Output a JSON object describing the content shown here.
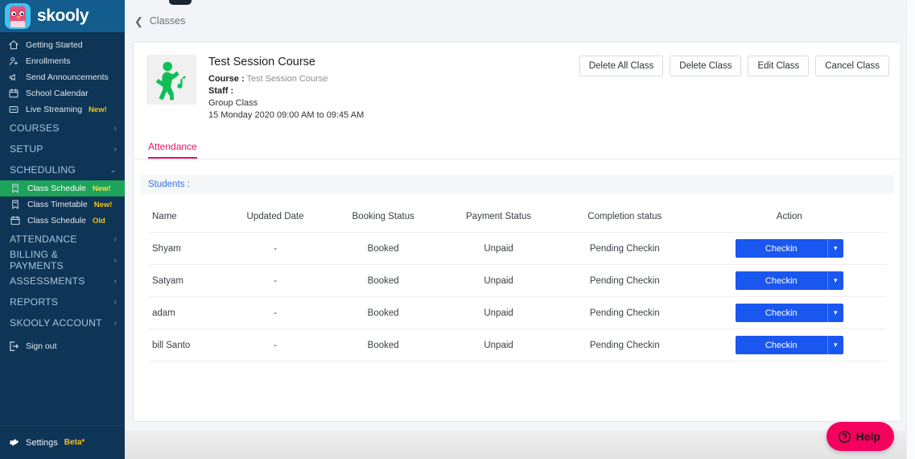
{
  "brand": {
    "name": "skooly",
    "logo_icon": "owl-logo-icon",
    "bar_color": "#125d8e"
  },
  "sidebar": {
    "items": [
      {
        "label": "Getting Started",
        "icon": "home-icon"
      },
      {
        "label": "Enrollments",
        "icon": "person-add-icon"
      },
      {
        "label": "Send Announcements",
        "icon": "megaphone-icon"
      },
      {
        "label": "School Calendar",
        "icon": "calendar-icon"
      },
      {
        "label": "Live Streaming",
        "icon": "video-icon",
        "badge": "New!"
      }
    ],
    "groups": [
      {
        "label": "COURSES",
        "chevron": "›",
        "expanded": false
      },
      {
        "label": "SETUP",
        "chevron": "›",
        "expanded": false
      },
      {
        "label": "SCHEDULING",
        "chevron": "⌄",
        "expanded": true
      }
    ],
    "scheduling_children": [
      {
        "label": "Class Schedule",
        "icon": "bookmark-icon",
        "badge": "New!",
        "active": true
      },
      {
        "label": "Class Timetable",
        "icon": "bookmark-icon",
        "badge": "New!",
        "active": false
      },
      {
        "label": "Class Schedule",
        "icon": "calendar-icon",
        "badge": "Old",
        "active": false
      }
    ],
    "groups_after": [
      {
        "label": "ATTENDANCE",
        "chevron": "›"
      },
      {
        "label": "BILLING & PAYMENTS",
        "chevron": "›"
      },
      {
        "label": "ASSESSMENTS",
        "chevron": "›"
      },
      {
        "label": "REPORTS",
        "chevron": "›"
      },
      {
        "label": "SKOOLY ACCOUNT",
        "chevron": "›"
      }
    ],
    "sign_out": {
      "label": "Sign out",
      "icon": "sign-out-icon"
    },
    "footer": {
      "label": "Settings",
      "badge": "Beta*",
      "icon": "gear-icon"
    },
    "active_color": "#1da35a",
    "badge_color": "#f6c11b"
  },
  "breadcrumb": {
    "back_icon": "chevron-left-icon",
    "label": "Classes"
  },
  "course": {
    "thumb_icon": "dancing-person-music-icon",
    "title": "Test Session Course",
    "course_label": "Course :",
    "course_value": "Test Session Course",
    "staff_label": "Staff :",
    "staff_value": "",
    "class_type": "Group Class",
    "schedule": "15 Monday 2020 09:00 AM to 09:45 AM"
  },
  "header_actions": [
    {
      "label": "Delete All Class"
    },
    {
      "label": "Delete Class"
    },
    {
      "label": "Edit Class"
    },
    {
      "label": "Cancel Class"
    }
  ],
  "tabs": [
    {
      "label": "Attendance",
      "active": true,
      "color": "#ed1164"
    }
  ],
  "students_section": {
    "label": "Students :",
    "color": "#2f72f0"
  },
  "table": {
    "columns": [
      "Name",
      "Updated Date",
      "Booking Status",
      "Payment Status",
      "Completion status",
      "Action"
    ],
    "rows": [
      {
        "name": "Shyam",
        "updated_date": "-",
        "booking_status": "Booked",
        "payment_status": "Unpaid",
        "completion_status": "Pending Checkin",
        "action_label": "Checkin"
      },
      {
        "name": "Satyam",
        "updated_date": "-",
        "booking_status": "Booked",
        "payment_status": "Unpaid",
        "completion_status": "Pending Checkin",
        "action_label": "Checkin"
      },
      {
        "name": "adam",
        "updated_date": "-",
        "booking_status": "Booked",
        "payment_status": "Unpaid",
        "completion_status": "Pending Checkin",
        "action_label": "Checkin"
      },
      {
        "name": "bill Santo",
        "updated_date": "-",
        "booking_status": "Booked",
        "payment_status": "Unpaid",
        "completion_status": "Pending Checkin",
        "action_label": "Checkin"
      }
    ],
    "action_button_color": "#1a56f0",
    "dropdown_icon": "chevron-down-icon"
  },
  "help": {
    "label": "Help",
    "icon": "question-circle-icon",
    "color": "#f5005e"
  }
}
